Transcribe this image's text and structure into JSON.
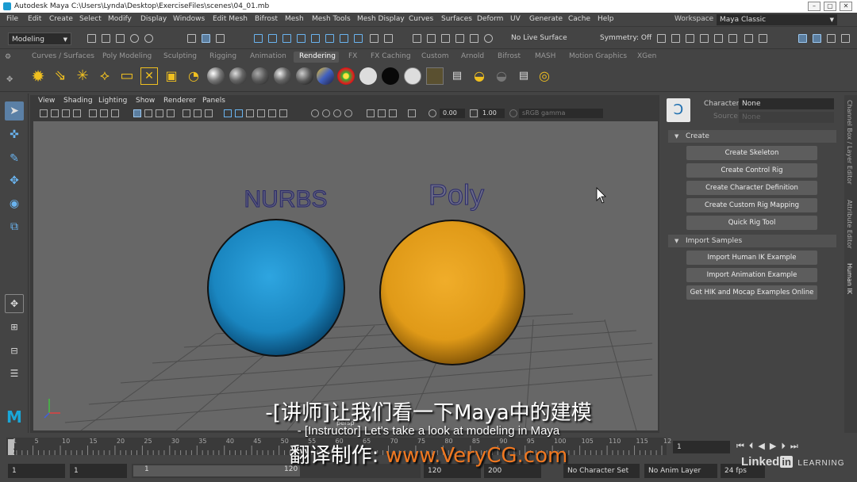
{
  "window": {
    "title": "Autodesk Maya  C:\\Users\\Lynda\\Desktop\\ExerciseFiles\\scenes\\04_01.mb"
  },
  "menubar": {
    "items": [
      "File",
      "Edit",
      "Create",
      "Select",
      "Modify",
      "Display",
      "Windows",
      "Edit Mesh",
      "Bifrost",
      "Mesh",
      "Mesh Tools",
      "Mesh Display",
      "Curves",
      "Surfaces",
      "Deform",
      "UV",
      "Generate",
      "Cache",
      "Help"
    ],
    "workspace_label": "Workspace :",
    "workspace_value": "Maya Classic"
  },
  "statusline": {
    "mode": "Modeling",
    "live_surface": "No Live Surface",
    "symmetry": "Symmetry: Off"
  },
  "shelf": {
    "tabs": [
      "Curves / Surfaces",
      "Poly Modeling",
      "Sculpting",
      "Rigging",
      "Animation",
      "Rendering",
      "FX",
      "FX Caching",
      "Custom",
      "Arnold",
      "Bifrost",
      "MASH",
      "Motion Graphics",
      "XGen"
    ],
    "active_tab": "Rendering"
  },
  "viewport": {
    "menu": [
      "View",
      "Shading",
      "Lighting",
      "Show",
      "Renderer",
      "Panels"
    ],
    "exposure": "0.00",
    "gamma": "1.00",
    "color_space": "sRGB gamma",
    "camera_label": "persp",
    "objects": [
      {
        "label": "NURBS",
        "color": "#1a86c0"
      },
      {
        "label": "Poly",
        "color": "#e09a18"
      }
    ]
  },
  "human_ik": {
    "character_label": "Character:",
    "character_value": "None",
    "source_label": "Source:",
    "source_value": "None",
    "sections": [
      {
        "title": "Create",
        "buttons": [
          "Create Skeleton",
          "Create Control Rig",
          "Create Character Definition",
          "Create Custom Rig Mapping",
          "Quick Rig Tool"
        ]
      },
      {
        "title": "Import Samples",
        "buttons": [
          "Import Human IK Example",
          "Import Animation Example",
          "Get HIK and Mocap Examples Online"
        ]
      }
    ]
  },
  "side_tabs": [
    "Channel Box / Layer Editor",
    "Attribute Editor",
    "Human IK"
  ],
  "timeline": {
    "ticks": [
      "1",
      "5",
      "10",
      "15",
      "20",
      "25",
      "30",
      "35",
      "40",
      "45",
      "50",
      "55",
      "60",
      "65",
      "70",
      "75",
      "80",
      "85",
      "90",
      "95",
      "100",
      "105",
      "110",
      "115",
      "12"
    ],
    "current_frame": "1",
    "range_start": "1",
    "range_inner_start": "1",
    "range_slider_start": "1",
    "range_slider_end": "120",
    "range_inner_end": "120",
    "range_end": "200",
    "character_set": "No Character Set",
    "anim_layer": "No Anim Layer",
    "fps": "24 fps"
  },
  "subtitles": {
    "chinese": "-[讲师]让我们看一下Maya中的建模",
    "english": "- [Instructor] Let's take a look at modeling in Maya",
    "credit_prefix": "翻译制作: ",
    "credit_url": "www.VeryCG.com"
  },
  "watermark": {
    "brand_prefix": "Linked",
    "brand_in": "in",
    "brand_suffix": "LEARNING"
  },
  "colors": {
    "selection_blue": "#5b80a6",
    "nurbs_sphere": "#1a86c0",
    "poly_sphere": "#e09a18",
    "viewport_bg": "#676767"
  }
}
